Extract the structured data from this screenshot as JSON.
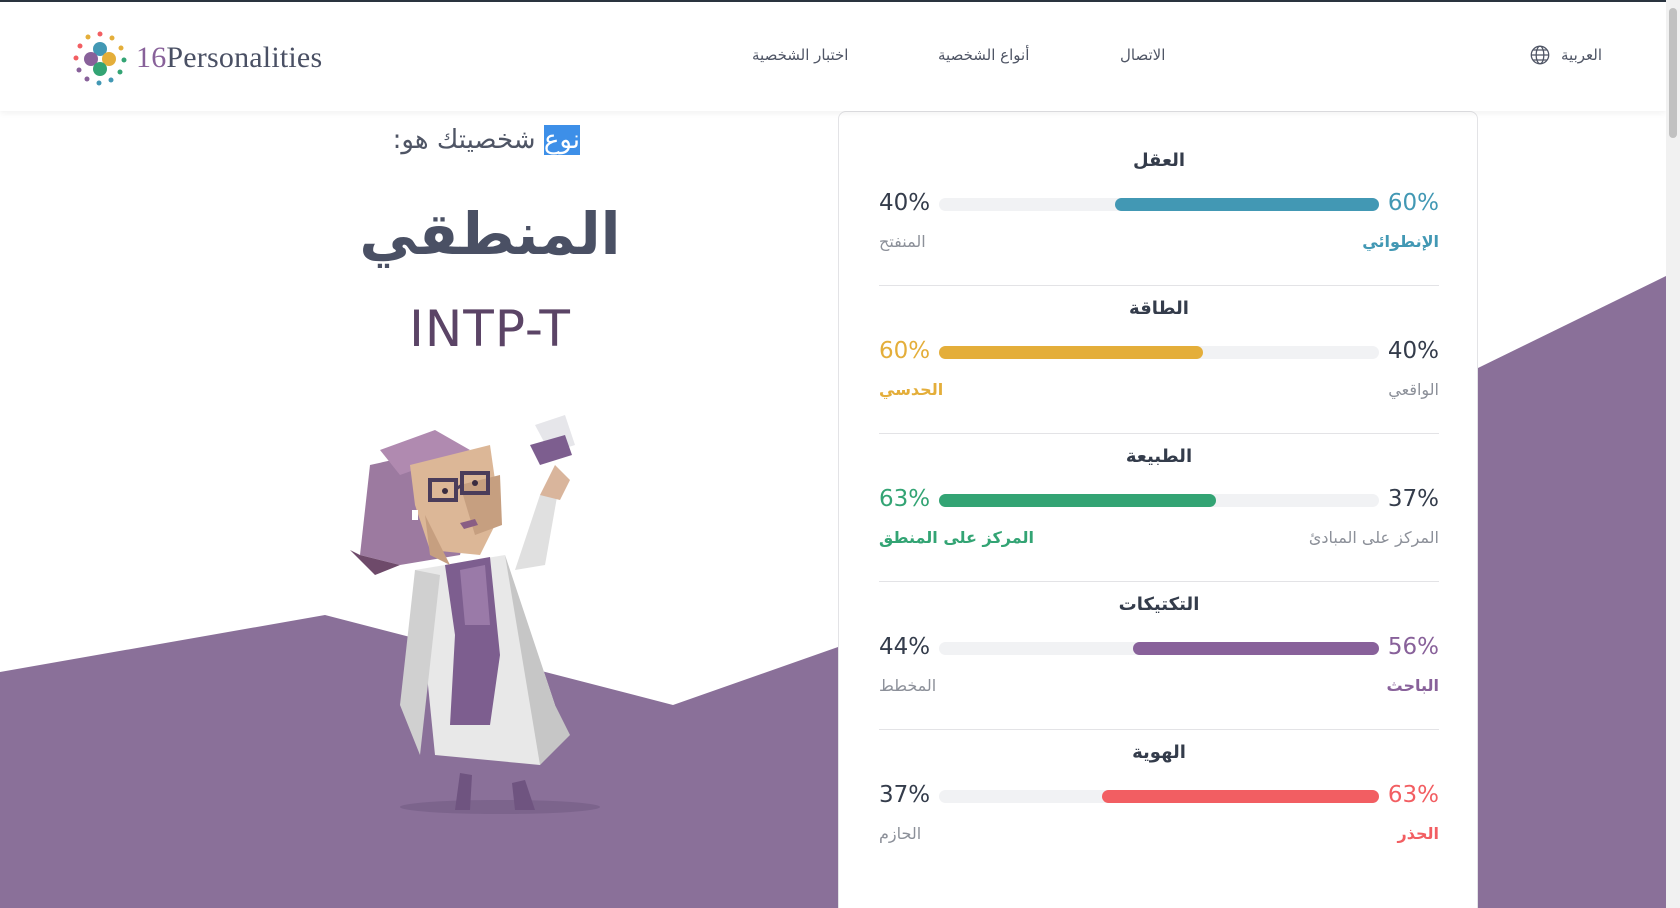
{
  "header": {
    "brand_number": "16",
    "brand_name": "Personalities",
    "nav": [
      {
        "label": "اختبار الشخصية"
      },
      {
        "label": "أنواع الشخصية"
      },
      {
        "label": "الاتصال"
      }
    ],
    "language": "العربية"
  },
  "result": {
    "intro_highlight": "نوع",
    "intro_rest": " شخصيتك هو:",
    "type_name": "المنطقي",
    "type_code": "INTP-T"
  },
  "traits": [
    {
      "title": "العقل",
      "left_pct": "40%",
      "right_pct": "60%",
      "left_label": "المنفتح",
      "right_label": "الإنطوائي",
      "color": "#4298b4",
      "fill_side": "right",
      "fill_fraction": 0.6,
      "highlight": "right"
    },
    {
      "title": "الطاقة",
      "left_pct": "60%",
      "right_pct": "40%",
      "left_label": "الحدسي",
      "right_label": "الواقعي",
      "color": "#e4ae3a",
      "fill_side": "left",
      "fill_fraction": 0.6,
      "highlight": "left"
    },
    {
      "title": "الطبيعة",
      "left_pct": "63%",
      "right_pct": "37%",
      "left_label": "المركز على المنطق",
      "right_label": "المركز على المبادئ",
      "color": "#33a474",
      "fill_side": "left",
      "fill_fraction": 0.63,
      "highlight": "left"
    },
    {
      "title": "التكتيكات",
      "left_pct": "44%",
      "right_pct": "56%",
      "left_label": "المخطط",
      "right_label": "الباحث",
      "color": "#88619a",
      "fill_side": "right",
      "fill_fraction": 0.56,
      "highlight": "right"
    },
    {
      "title": "الهوية",
      "left_pct": "37%",
      "right_pct": "63%",
      "left_label": "الحازم",
      "right_label": "الحذر",
      "color": "#f25e62",
      "fill_side": "right",
      "fill_fraction": 0.63,
      "highlight": "right"
    }
  ],
  "colors": {
    "background_shape": "#8a7099",
    "heading": "#4a5064",
    "type_code": "#5b4466",
    "selection": "#3d8fe8"
  },
  "icons": [
    "logo-mark-icon",
    "globe-icon",
    "scientist-illustration"
  ]
}
